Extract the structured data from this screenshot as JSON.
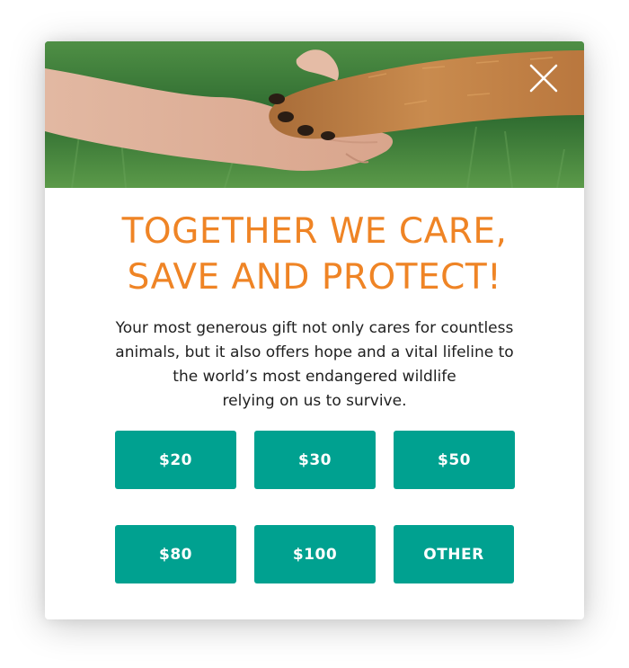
{
  "modal": {
    "close_icon": "close-icon",
    "title_lines": [
      "TOGETHER WE CARE,",
      "SAVE AND PROTECT!"
    ],
    "body_lines": [
      "Your most generous gift not only cares for countless",
      "animals, but it also offers hope and a vital lifeline to",
      "the world’s most endangered wildlife",
      "relying on us to survive."
    ],
    "amounts": [
      "$20",
      "$30",
      "$50",
      "$80",
      "$100",
      "OTHER"
    ]
  },
  "colors": {
    "title": "#ef8425",
    "button": "#00a190",
    "button_text": "#ffffff",
    "body_text": "#1f1f1f"
  }
}
